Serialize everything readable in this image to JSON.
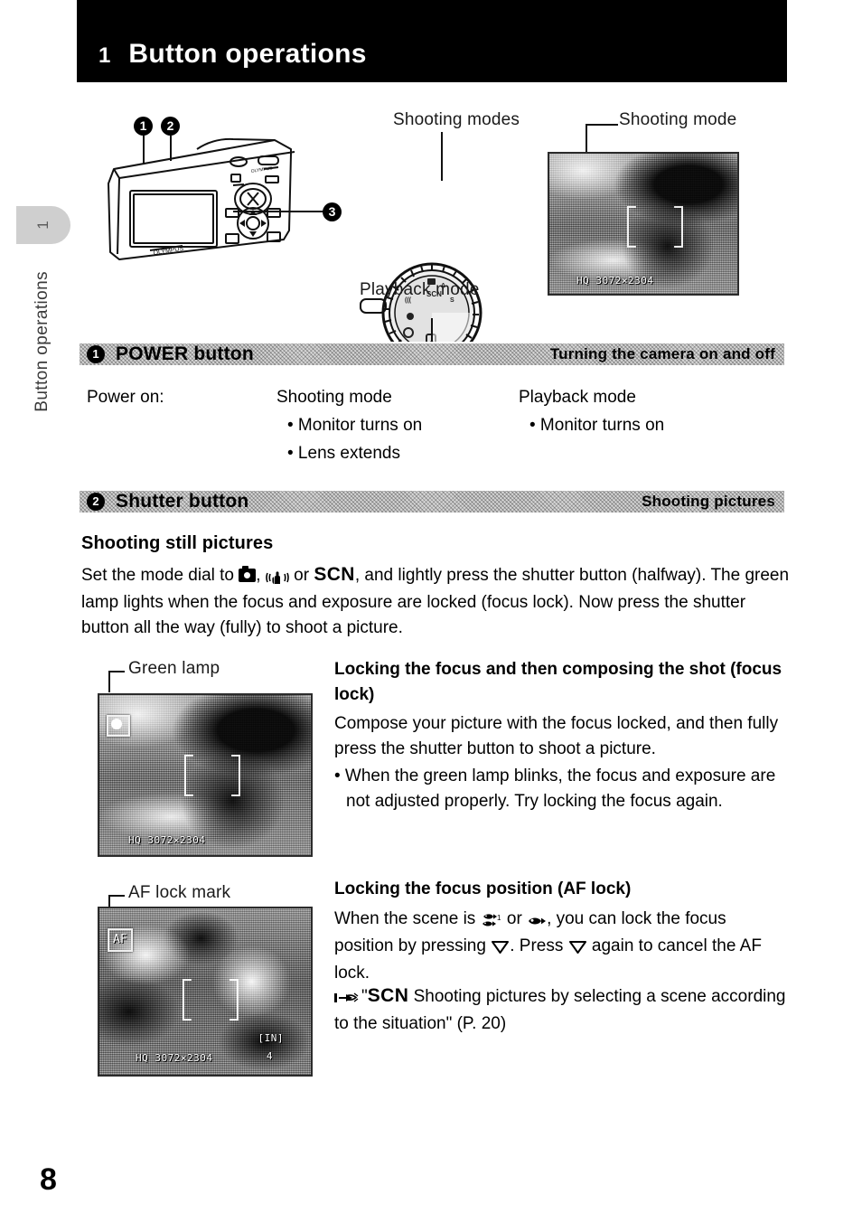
{
  "chapter": {
    "number": "1",
    "title": "Button operations"
  },
  "side_tab": {
    "number": "1",
    "label": "Button operations"
  },
  "figure": {
    "callouts": [
      {
        "id": "1",
        "label": "1"
      },
      {
        "id": "2",
        "label": "2"
      },
      {
        "id": "3",
        "label": "3"
      }
    ],
    "labels": {
      "shooting_modes": "Shooting modes",
      "playback_mode": "Playback mode",
      "shooting_mode": "Shooting mode"
    },
    "lcd_preview_osd": "HQ 3072×2304"
  },
  "sections": [
    {
      "badge": "1",
      "title": "POWER button",
      "subtitle": "Turning the camera on and off"
    },
    {
      "badge": "2",
      "title": "Shutter button",
      "subtitle": "Shooting pictures"
    }
  ],
  "power": {
    "row_label": "Power on:",
    "col1_head": "Shooting mode",
    "col1_items": [
      "• Monitor turns on",
      "• Lens extends"
    ],
    "col2_head": "Playback mode",
    "col2_items": [
      "• Monitor turns on"
    ]
  },
  "shutter": {
    "heading": "Shooting still pictures",
    "intro_a": "Set the mode dial to",
    "intro_icon_camera": "camera-mode-icon",
    "intro_comma": ",",
    "intro_icon_stabilizer": "image-stabilization-icon",
    "intro_or": "or",
    "intro_scn": "SCN",
    "intro_b": ", and lightly press the shutter button (halfway). The green lamp lights when the focus and exposure are locked (focus lock). Now press the shutter button all the way (fully) to shoot a picture."
  },
  "focus_lock": {
    "figure_label": "Green lamp",
    "lcd_osd": "HQ 3072×2304",
    "heading": "Locking the focus and then composing the shot (focus lock)",
    "body": "Compose your picture with the focus locked, and then fully press the shutter button to shoot a picture.",
    "bullet": "• When the green lamp blinks, the focus and exposure are not adjusted properly. Try locking the focus again."
  },
  "af_lock": {
    "figure_label": "AF lock mark",
    "lcd_mark": "AF",
    "lcd_osd_main": "HQ 3072×2304",
    "lcd_osd_memory": "[IN]",
    "lcd_osd_count": "4",
    "heading": "Locking the focus position (AF lock)",
    "body_a": "When the scene is",
    "icon_underwater_wide": "underwater-wide-fish-icon",
    "body_or": "or",
    "icon_underwater_macro": "underwater-macro-fish-icon",
    "body_b": ", you can lock the focus position by pressing",
    "icon_down_1": "down-arrow-pad-icon",
    "body_c": ". Press",
    "icon_down_2": "down-arrow-pad-icon",
    "body_d": "again to cancel the AF lock.",
    "ref_icon": "pointing-hand-icon",
    "ref_quote_open": "\"",
    "ref_scn": "SCN",
    "ref_text": "Shooting pictures by selecting a scene according to the situation\" (P. 20)"
  },
  "page_number": "8",
  "colors": {
    "header_bar": "#000000",
    "section_bar": "#d7d7d7",
    "tab": "#cfcfcf",
    "text": "#000000"
  }
}
